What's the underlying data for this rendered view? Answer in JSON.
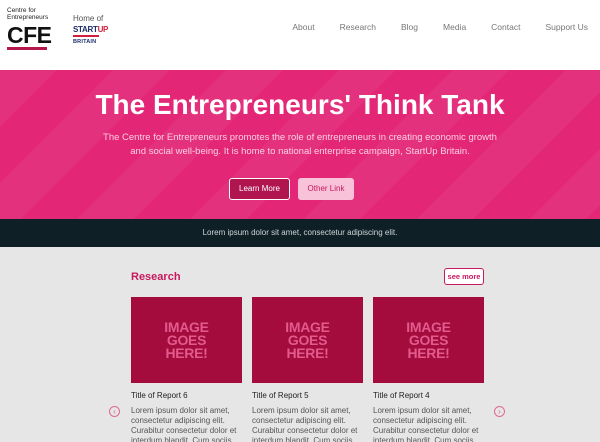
{
  "logo": {
    "small_line1": "Centre for",
    "small_line2": "Entrepreneurs",
    "big": "CFE"
  },
  "partner": {
    "home_of": "Home of",
    "start": "START",
    "up": "UP",
    "britain": "BRITAIN"
  },
  "nav": [
    "About",
    "Research",
    "Blog",
    "Media",
    "Contact",
    "Support Us"
  ],
  "hero": {
    "title": "The Entrepreneurs' Think Tank",
    "text": "The Centre for Entrepreneurs promotes the role of entrepreneurs in creating economic growth and social well-being. It is home to national enterprise campaign, StartUp Britain.",
    "learn_more": "Learn More",
    "other_link": "Other Link"
  },
  "strip": {
    "text": "Lorem ipsum dolor sit amet, consectetur adipiscing elit."
  },
  "research": {
    "title": "Research",
    "see_more": "see more",
    "placeholder": "IMAGE GOES HERE!",
    "cards": [
      {
        "title": "Title of Report 6",
        "desc": "Lorem ipsum dolor sit amet, consectetur adipiscing elit. Curabitur consectetur dolor et interdum blandit. Cum sociis"
      },
      {
        "title": "Title of Report 5",
        "desc": "Lorem ipsum dolor sit amet, consectetur adipiscing elit. Curabitur consectetur dolor et interdum blandit. Cum sociis"
      },
      {
        "title": "Title of Report 4",
        "desc": "Lorem ipsum dolor sit amet, consectetur adipiscing elit. Curabitur consectetur dolor et interdum blandit. Cum sociis"
      }
    ]
  },
  "icons": {
    "prev": "chevron-left-icon",
    "next": "chevron-right-icon"
  },
  "colors": {
    "accent": "#e32676",
    "dark": "#0f1f26",
    "card": "#a30c3c"
  }
}
